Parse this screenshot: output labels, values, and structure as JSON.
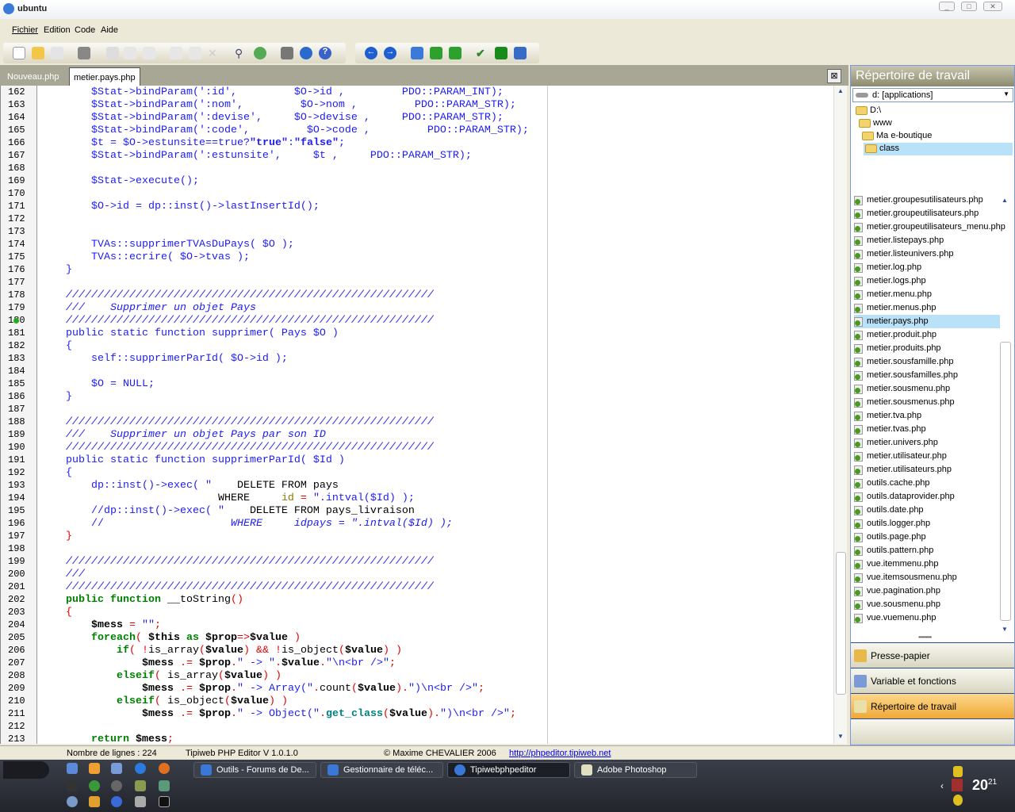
{
  "window": {
    "title": "ubuntu"
  },
  "menu": [
    "Fichier",
    "Edition",
    "Code",
    "Aide"
  ],
  "toolbar": {
    "icons": [
      "new-file-icon",
      "open-folder-icon",
      "save-icon",
      "print-icon",
      "cut-icon",
      "copy-icon",
      "paste-icon",
      "undo-icon",
      "redo-icon",
      "delete-icon",
      "find-icon",
      "replace-icon",
      "home-icon",
      "web-icon",
      "help-icon",
      "back-icon",
      "forward-icon",
      "tree-icon",
      "collapse-icon",
      "expand-icon",
      "check-icon",
      "run-icon",
      "preview-icon"
    ]
  },
  "tabs": [
    {
      "label": "Nouveau.php",
      "active": false
    },
    {
      "label": "metier.pays.php",
      "active": true
    }
  ],
  "editor": {
    "lines": [
      {
        "n": "162",
        "t": [
          [
            "        $Stat->bindParam(':id',         $O->id ,         PDO::PARAM_INT);",
            "b"
          ]
        ]
      },
      {
        "n": "163",
        "t": [
          [
            "        $Stat->bindParam(':nom',         $O->nom ,         PDO::PARAM_STR);",
            "b"
          ]
        ]
      },
      {
        "n": "164",
        "t": [
          [
            "        $Stat->bindParam(':devise',     $O->devise ,     PDO::PARAM_STR);",
            "b"
          ]
        ]
      },
      {
        "n": "165",
        "t": [
          [
            "        $Stat->bindParam(':code',         $O->code ,         PDO::PARAM_STR);",
            "b"
          ]
        ]
      },
      {
        "n": "166",
        "t": [
          [
            "        $t = $O->estunsite==true?",
            "b"
          ],
          [
            "\"true\"",
            "s"
          ],
          [
            ":",
            "b"
          ],
          [
            "\"false\"",
            "s"
          ],
          [
            ";",
            "b"
          ]
        ]
      },
      {
        "n": "167",
        "t": [
          [
            "        $Stat->bindParam(':estunsite',     $t ,     PDO::PARAM_STR);",
            "b"
          ]
        ]
      },
      {
        "n": "168",
        "t": []
      },
      {
        "n": "169",
        "t": [
          [
            "        $Stat->execute();",
            "b"
          ]
        ]
      },
      {
        "n": "170",
        "t": []
      },
      {
        "n": "171",
        "t": [
          [
            "        $O->id = dp::inst()->lastInsertId();",
            "b"
          ]
        ]
      },
      {
        "n": "172",
        "t": []
      },
      {
        "n": "173",
        "t": []
      },
      {
        "n": "174",
        "t": [
          [
            "        TVAs::supprimerTVAsDuPays( $O );",
            "b"
          ]
        ]
      },
      {
        "n": "175",
        "t": [
          [
            "        TVAs::ecrire( $O->tvas );",
            "b"
          ]
        ]
      },
      {
        "n": "176",
        "t": [
          [
            "    }",
            "b"
          ]
        ]
      },
      {
        "n": "177",
        "t": []
      },
      {
        "n": "178",
        "t": [
          [
            "    //////////////////////////////////////////////////////////",
            "c"
          ]
        ]
      },
      {
        "n": "179",
        "t": [
          [
            "    ///    Supprimer un objet Pays",
            "c"
          ]
        ]
      },
      {
        "n": "180",
        "t": [
          [
            "    //////////////////////////////////////////////////////////",
            "c"
          ]
        ]
      },
      {
        "n": "181",
        "t": [
          [
            "    public static function supprimer( Pays $O )",
            "b"
          ]
        ]
      },
      {
        "n": "182",
        "t": [
          [
            "    {",
            "b"
          ]
        ]
      },
      {
        "n": "183",
        "t": [
          [
            "        self::supprimerParId( $O->id );",
            "b"
          ]
        ]
      },
      {
        "n": "184",
        "t": []
      },
      {
        "n": "185",
        "t": [
          [
            "        $O = NULL;",
            "b"
          ]
        ]
      },
      {
        "n": "186",
        "t": [
          [
            "    }",
            "b"
          ]
        ]
      },
      {
        "n": "187",
        "t": []
      },
      {
        "n": "188",
        "t": [
          [
            "    //////////////////////////////////////////////////////////",
            "c"
          ]
        ]
      },
      {
        "n": "189",
        "t": [
          [
            "    ///    Supprimer un objet Pays par son ID",
            "c"
          ]
        ]
      },
      {
        "n": "190",
        "t": [
          [
            "    //////////////////////////////////////////////////////////",
            "c"
          ]
        ]
      },
      {
        "n": "191",
        "t": [
          [
            "    public static function supprimerParId( $Id )",
            "b"
          ]
        ]
      },
      {
        "n": "192",
        "t": [
          [
            "    {",
            "b"
          ]
        ]
      },
      {
        "n": "193",
        "t": [
          [
            "        dp::inst()->exec( \"",
            "b"
          ],
          [
            "    DELETE FROM pays",
            "p"
          ]
        ]
      },
      {
        "n": "194",
        "t": [
          [
            "                            WHERE     ",
            "p"
          ],
          [
            "id",
            "o"
          ],
          [
            " = ",
            "r"
          ],
          [
            "\".intval($Id) );",
            "b"
          ]
        ]
      },
      {
        "n": "195",
        "t": [
          [
            "        //dp::inst()->exec( \"",
            "b"
          ],
          [
            "    DELETE FROM pays_livraison",
            "p"
          ]
        ]
      },
      {
        "n": "196",
        "t": [
          [
            "        //",
            "b"
          ],
          [
            "                    WHERE     idpays = \".intval($Id) );",
            "c"
          ]
        ]
      },
      {
        "n": "197",
        "t": [
          [
            "    }",
            "r"
          ]
        ]
      },
      {
        "n": "198",
        "t": []
      },
      {
        "n": "199",
        "t": [
          [
            "    //////////////////////////////////////////////////////////",
            "c"
          ]
        ]
      },
      {
        "n": "200",
        "t": [
          [
            "    ///",
            "c"
          ]
        ]
      },
      {
        "n": "201",
        "t": [
          [
            "    //////////////////////////////////////////////////////////",
            "c"
          ]
        ]
      },
      {
        "n": "202",
        "t": [
          [
            "    ",
            "p"
          ],
          [
            "public function",
            "k"
          ],
          [
            " __toString",
            "p"
          ],
          [
            "()",
            "r"
          ]
        ]
      },
      {
        "n": "203",
        "t": [
          [
            "    ",
            "p"
          ],
          [
            "{",
            "r"
          ]
        ]
      },
      {
        "n": "204",
        "t": [
          [
            "        ",
            "p"
          ],
          [
            "$mess",
            "v"
          ],
          [
            " = ",
            "r"
          ],
          [
            "\"\"",
            "b"
          ],
          [
            ";",
            "r"
          ]
        ]
      },
      {
        "n": "205",
        "t": [
          [
            "        ",
            "p"
          ],
          [
            "foreach",
            "k"
          ],
          [
            "(",
            "r"
          ],
          [
            " ",
            "p"
          ],
          [
            "$this",
            "v"
          ],
          [
            " ",
            "p"
          ],
          [
            "as",
            "k"
          ],
          [
            " ",
            "p"
          ],
          [
            "$prop",
            "v"
          ],
          [
            "=>",
            "r"
          ],
          [
            "$value",
            "v"
          ],
          [
            " ",
            "p"
          ],
          [
            ")",
            "r"
          ]
        ]
      },
      {
        "n": "206",
        "t": [
          [
            "            ",
            "p"
          ],
          [
            "if",
            "k"
          ],
          [
            "(",
            "r"
          ],
          [
            " ",
            "p"
          ],
          [
            "!",
            "r"
          ],
          [
            "is_array",
            "p"
          ],
          [
            "(",
            "r"
          ],
          [
            "$value",
            "v"
          ],
          [
            ")",
            "r"
          ],
          [
            " ",
            "p"
          ],
          [
            "&&",
            "r"
          ],
          [
            " ",
            "p"
          ],
          [
            "!",
            "r"
          ],
          [
            "is_object",
            "p"
          ],
          [
            "(",
            "r"
          ],
          [
            "$value",
            "v"
          ],
          [
            ")",
            "r"
          ],
          [
            " ",
            "p"
          ],
          [
            ")",
            "r"
          ]
        ]
      },
      {
        "n": "207",
        "t": [
          [
            "                ",
            "p"
          ],
          [
            "$mess",
            "v"
          ],
          [
            " ",
            "p"
          ],
          [
            ".=",
            "r"
          ],
          [
            " ",
            "p"
          ],
          [
            "$prop",
            "v"
          ],
          [
            ".",
            "r"
          ],
          [
            "\" -> \"",
            "b"
          ],
          [
            ".",
            "r"
          ],
          [
            "$value",
            "v"
          ],
          [
            ".",
            "r"
          ],
          [
            "\"\\n<br />\"",
            "b"
          ],
          [
            ";",
            "r"
          ]
        ]
      },
      {
        "n": "208",
        "t": [
          [
            "            ",
            "p"
          ],
          [
            "elseif",
            "k"
          ],
          [
            "(",
            "r"
          ],
          [
            " is_array",
            "p"
          ],
          [
            "(",
            "r"
          ],
          [
            "$value",
            "v"
          ],
          [
            ")",
            "r"
          ],
          [
            " ",
            "p"
          ],
          [
            ")",
            "r"
          ]
        ]
      },
      {
        "n": "209",
        "t": [
          [
            "                ",
            "p"
          ],
          [
            "$mess",
            "v"
          ],
          [
            " ",
            "p"
          ],
          [
            ".=",
            "r"
          ],
          [
            " ",
            "p"
          ],
          [
            "$prop",
            "v"
          ],
          [
            ".",
            "r"
          ],
          [
            "\" -> Array(\"",
            "b"
          ],
          [
            ".",
            "r"
          ],
          [
            "count",
            "p"
          ],
          [
            "(",
            "r"
          ],
          [
            "$value",
            "v"
          ],
          [
            ")",
            "r"
          ],
          [
            ".",
            "r"
          ],
          [
            "\")\\n<br />\"",
            "b"
          ],
          [
            ";",
            "r"
          ]
        ]
      },
      {
        "n": "210",
        "t": [
          [
            "            ",
            "p"
          ],
          [
            "elseif",
            "k"
          ],
          [
            "(",
            "r"
          ],
          [
            " is_object",
            "p"
          ],
          [
            "(",
            "r"
          ],
          [
            "$value",
            "v"
          ],
          [
            ")",
            "r"
          ],
          [
            " ",
            "p"
          ],
          [
            ")",
            "r"
          ]
        ]
      },
      {
        "n": "211",
        "t": [
          [
            "                ",
            "p"
          ],
          [
            "$mess",
            "v"
          ],
          [
            " ",
            "p"
          ],
          [
            ".=",
            "r"
          ],
          [
            " ",
            "p"
          ],
          [
            "$prop",
            "v"
          ],
          [
            ".",
            "r"
          ],
          [
            "\" -> Object(\"",
            "b"
          ],
          [
            ".",
            "r"
          ],
          [
            "get_class",
            "g"
          ],
          [
            "(",
            "r"
          ],
          [
            "$value",
            "v"
          ],
          [
            ")",
            "r"
          ],
          [
            ".",
            "r"
          ],
          [
            "\")\\n<br />\"",
            "b"
          ],
          [
            ";",
            "r"
          ]
        ]
      },
      {
        "n": "212",
        "t": []
      },
      {
        "n": "213",
        "t": [
          [
            "        ",
            "p"
          ],
          [
            "return",
            "k"
          ],
          [
            " ",
            "p"
          ],
          [
            "$mess",
            "v"
          ],
          [
            ";",
            "r"
          ]
        ]
      }
    ],
    "breakpoint_line": "180"
  },
  "panel": {
    "title": "Répertoire de travail",
    "drive": "d: [applications]",
    "tree": [
      "D:\\",
      "www",
      "Ma e-boutique",
      "class"
    ],
    "selected_folder": "class",
    "files": [
      "metier.groupesutilisateurs.php",
      "metier.groupeutilisateurs.php",
      "metier.groupeutilisateurs_menu.php",
      "metier.listepays.php",
      "metier.listeunivers.php",
      "metier.log.php",
      "metier.logs.php",
      "metier.menu.php",
      "metier.menus.php",
      "metier.pays.php",
      "metier.produit.php",
      "metier.produits.php",
      "metier.sousfamille.php",
      "metier.sousfamilles.php",
      "metier.sousmenu.php",
      "metier.sousmenus.php",
      "metier.tva.php",
      "metier.tvas.php",
      "metier.univers.php",
      "metier.utilisateur.php",
      "metier.utilisateurs.php",
      "outils.cache.php",
      "outils.dataprovider.php",
      "outils.date.php",
      "outils.logger.php",
      "outils.page.php",
      "outils.pattern.php",
      "vue.itemmenu.php",
      "vue.itemsousmenu.php",
      "vue.pagination.php",
      "vue.sousmenu.php",
      "vue.vuemenu.php"
    ],
    "selected_file": "metier.pays.php",
    "buttons": [
      {
        "label": "Presse-papier",
        "active": false
      },
      {
        "label": "Variable et fonctions",
        "active": false
      },
      {
        "label": "Répertoire de travail",
        "active": true
      }
    ]
  },
  "status": {
    "lines": "Nombre de lignes : 224",
    "app": "Tipiweb PHP Editor V 1.0.1.0",
    "copyright": "© Maxime CHEVALIER  2006",
    "link": "http://phpeditor.tipiweb.net"
  },
  "taskbar": {
    "items": [
      {
        "label": "Outils - Forums de De...",
        "active": false
      },
      {
        "label": "Gestionnaire de téléc...",
        "active": false
      },
      {
        "label": "Tipiwebphpeditor",
        "active": true
      },
      {
        "label": "Adobe Photoshop",
        "active": false
      }
    ],
    "clock_hour": "20",
    "clock_min": "21"
  },
  "colors": {
    "accent_orange": "#f3b041",
    "selection": "#b9e1f8",
    "keyword": "#008000",
    "code_blue": "#1d1df0"
  }
}
